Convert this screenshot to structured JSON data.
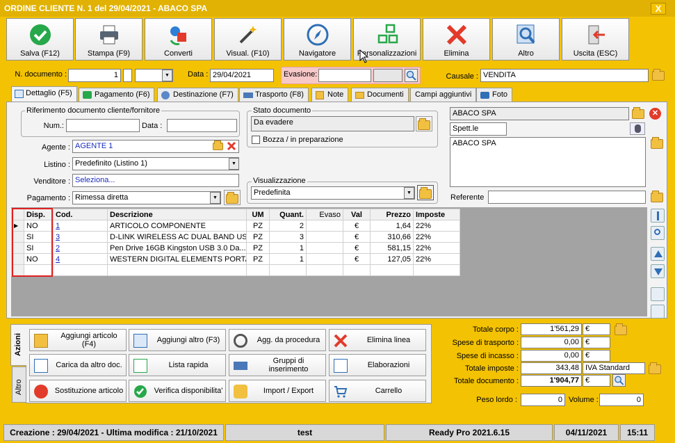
{
  "window": {
    "title": "ORDINE CLIENTE N. 1 del 29/04/2021 - ABACO SPA",
    "close": "X"
  },
  "toolbar": [
    {
      "name": "save",
      "label": "Salva (F12)",
      "icon": "check-icon"
    },
    {
      "name": "print",
      "label": "Stampa (F9)",
      "icon": "printer-icon"
    },
    {
      "name": "convert",
      "label": "Converti",
      "icon": "convert-icon"
    },
    {
      "name": "visual",
      "label": "Visual. (F10)",
      "icon": "magic-wand-icon"
    },
    {
      "name": "navigator",
      "label": "Navigatore",
      "icon": "compass-icon"
    },
    {
      "name": "custom",
      "label": "Personalizzazioni",
      "icon": "grid-icon"
    },
    {
      "name": "delete",
      "label": "Elimina",
      "icon": "x-icon"
    },
    {
      "name": "other",
      "label": "Altro",
      "icon": "magnifier-icon"
    },
    {
      "name": "exit",
      "label": "Uscita (ESC)",
      "icon": "exit-door-icon"
    }
  ],
  "header": {
    "ndoc_label": "N. documento :",
    "ndoc_value": "1",
    "data_label": "Data :",
    "data_value": "29/04/2021",
    "evasione_label": "Evasione:",
    "evasione_value": "",
    "causale_label": "Causale :",
    "causale_value": "VENDITA"
  },
  "tabs": [
    "Dettaglio (F5)",
    "Pagamento (F6)",
    "Destinazione (F7)",
    "Trasporto (F8)",
    "Note",
    "Documenti",
    "Campi aggiuntivi",
    "Foto"
  ],
  "rif": {
    "title": "Riferimento documento cliente/fornitore",
    "num_label": "Num.:",
    "num_value": "",
    "data_label": "Data :",
    "data_value": ""
  },
  "stato": {
    "title": "Stato documento",
    "value": "Da evadere",
    "bozza_label": "Bozza / in preparazione"
  },
  "fields": {
    "agente_label": "Agente :",
    "agente_value": "AGENTE 1",
    "listino_label": "Listino :",
    "listino_value": "Predefinito (Listino 1)",
    "venditore_label": "Venditore :",
    "venditore_value": "Seleziona...",
    "pagamento_label": "Pagamento :",
    "pagamento_value": "Rimessa diretta"
  },
  "visualizzazione": {
    "title": "Visualizzazione",
    "value": "Predefinita"
  },
  "cliente": {
    "name": "ABACO SPA",
    "spett": "Spett.le",
    "address": "ABACO SPA",
    "referente_label": "Referente",
    "referente_value": ""
  },
  "grid": {
    "headers": [
      "Disp.",
      "Cod.",
      "Descrizione",
      "UM",
      "Quant.",
      "Evaso",
      "Val",
      "Prezzo",
      "Imposte"
    ],
    "rows": [
      [
        "NO",
        "1",
        "ARTICOLO COMPONENTE",
        "PZ",
        "2",
        "",
        "€",
        "1,64",
        "22%"
      ],
      [
        "SI",
        "3",
        "D-LINK WIRELESS AC DUAL BAND US...",
        "PZ",
        "3",
        "",
        "€",
        "310,66",
        "22%"
      ],
      [
        "SI",
        "2",
        "Pen Drive 16GB  Kingston  USB 3.0 Da...",
        "PZ",
        "1",
        "",
        "€",
        "581,15",
        "22%"
      ],
      [
        "NO",
        "4",
        "WESTERN DIGITAL ELEMENTS PORTA...",
        "PZ",
        "1",
        "",
        "€",
        "127,05",
        "22%"
      ]
    ]
  },
  "side_tabs": [
    "Azioni",
    "Altro"
  ],
  "actions": [
    {
      "label": "Aggiungi articolo (F4)",
      "icon": "add-article-icon"
    },
    {
      "label": "Aggiungi altro (F3)",
      "icon": "add-other-icon"
    },
    {
      "label": "Agg. da procedura",
      "icon": "wrench-icon"
    },
    {
      "label": "Elimina linea",
      "icon": "delete-line-icon"
    },
    {
      "label": "Carica da altro doc.",
      "icon": "load-doc-icon"
    },
    {
      "label": "Lista rapida",
      "icon": "quick-list-icon"
    },
    {
      "label": "Gruppi di inserimento",
      "icon": "insert-group-icon"
    },
    {
      "label": "Elaborazioni",
      "icon": "process-icon"
    },
    {
      "label": "Sostituzione articolo",
      "icon": "replace-icon"
    },
    {
      "label": "Verifica disponibilita'",
      "icon": "verify-icon"
    },
    {
      "label": "Import / Export",
      "icon": "import-export-icon"
    },
    {
      "label": "Carrello",
      "icon": "cart-icon"
    }
  ],
  "totals": {
    "corpo_label": "Totale corpo :",
    "corpo_value": "1'561,29",
    "corpo_cur": "€",
    "trasporto_label": "Spese di trasporto :",
    "trasporto_value": "0,00",
    "trasporto_cur": "€",
    "incasso_label": "Spese di incasso :",
    "incasso_value": "0,00",
    "incasso_cur": "€",
    "imposte_label": "Totale imposte :",
    "imposte_value": "343,48",
    "imposte_cur": "IVA Standard",
    "documento_label": "Totale documento :",
    "documento_value": "1'904,77",
    "documento_cur": "€",
    "peso_label": "Peso lordo :",
    "peso_value": "0",
    "volume_label": "Volume :",
    "volume_value": "0"
  },
  "status": {
    "created": "Creazione : 29/04/2021 - Ultima modifica : 21/10/2021",
    "user": "test",
    "version": "Ready Pro 2021.6.15",
    "date": "04/11/2021",
    "time": "15:11"
  }
}
